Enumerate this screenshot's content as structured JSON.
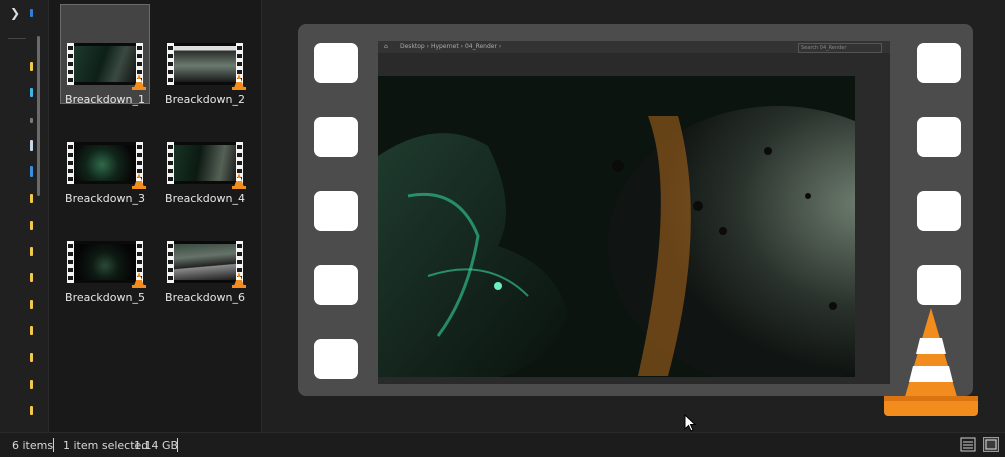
{
  "files": [
    {
      "name": "Breackdown_1",
      "selected": true
    },
    {
      "name": "Breackdown_2",
      "selected": false
    },
    {
      "name": "Breackdown_3",
      "selected": false
    },
    {
      "name": "Breackdown_4",
      "selected": false
    },
    {
      "name": "Breackdown_5",
      "selected": false
    },
    {
      "name": "Breackdown_6",
      "selected": false
    }
  ],
  "preview": {
    "breadcrumb": "Desktop  ›  Hypernet  ›  04_Render  ›",
    "search_placeholder": "Search 04_Render"
  },
  "status": {
    "item_count": "6 items",
    "selection": "1 item selected",
    "size": "1.14 GB"
  },
  "icons": {
    "expand": "chevron-right-icon",
    "details_view": "details-view-icon",
    "large_icons_view": "large-icons-view-icon",
    "app": "vlc-cone-icon"
  },
  "colors": {
    "accent": "#2f7fd8",
    "folder": "#f2c94c",
    "cone_orange": "#f28c1c"
  }
}
